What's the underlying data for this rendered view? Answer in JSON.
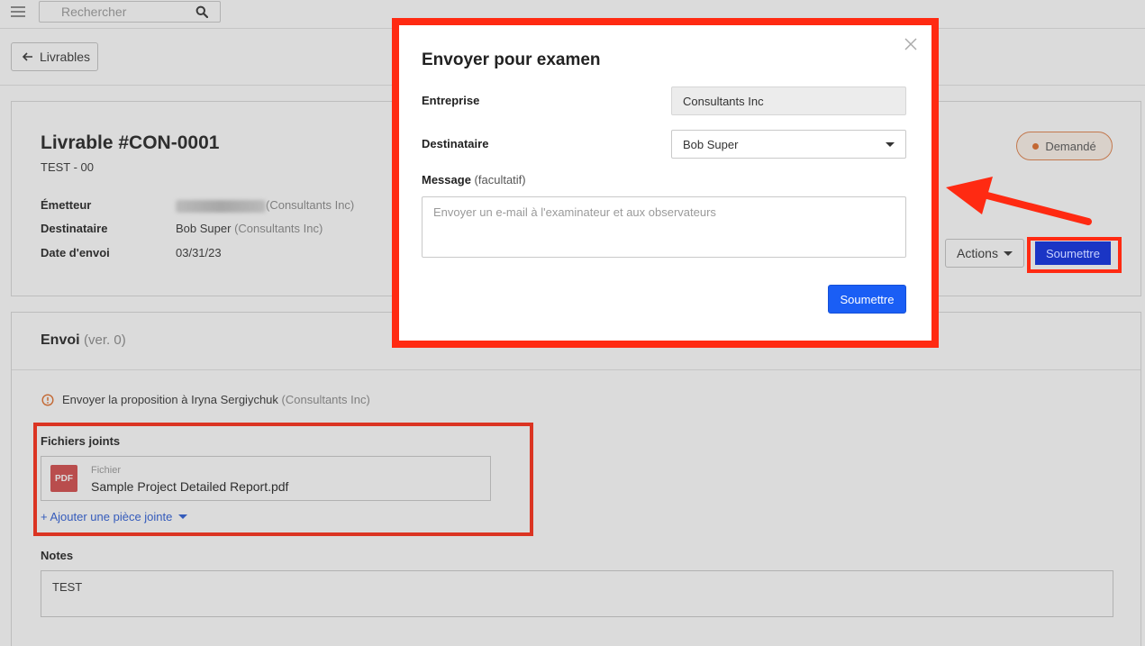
{
  "topbar": {
    "search_placeholder": "Rechercher"
  },
  "subbar": {
    "back_label": "Livrables"
  },
  "deliverable": {
    "title": "Livrable #CON-0001",
    "subtitle": "TEST - 00",
    "status": "Demandé",
    "fields": [
      {
        "label": "Émetteur",
        "value": "Iryna Sergiychuk",
        "company": "(Consultants Inc)"
      },
      {
        "label": "Destinataire",
        "value": "Bob Super",
        "company": "(Consultants Inc)"
      },
      {
        "label": "Date d'envoi",
        "value": "03/31/23"
      }
    ],
    "actions_label": "Actions",
    "submit_label": "Soumettre"
  },
  "submission": {
    "title": "Envoi",
    "version": "(ver. 0)",
    "warning_text": "Envoyer la proposition à Iryna Sergiychuk",
    "warning_company": "(Consultants Inc)",
    "attachments_title": "Fichiers joints",
    "file_icon_label": "PDF",
    "file_kind": "Fichier",
    "file_name": "Sample Project Detailed Report.pdf",
    "add_attachment": "+ Ajouter une pièce jointe",
    "notes_title": "Notes",
    "notes_value": "TEST"
  },
  "modal": {
    "title": "Envoyer pour examen",
    "company_label": "Entreprise",
    "company_value": "Consultants Inc",
    "recipient_label": "Destinataire",
    "recipient_value": "Bob Super",
    "message_label": "Message",
    "message_optional": "(facultatif)",
    "message_placeholder": "Envoyer un e-mail à l'examinateur et aux observateurs",
    "submit_label": "Soumettre"
  },
  "colors": {
    "highlight": "#ff2a12",
    "primary": "#1a5ef5",
    "status_accent": "#e06c28"
  }
}
